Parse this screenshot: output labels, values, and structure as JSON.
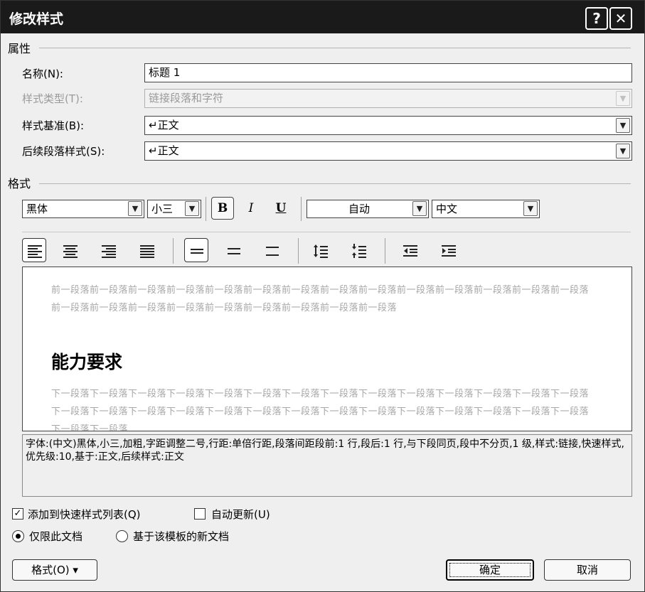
{
  "window": {
    "title": "修改样式",
    "help_label": "?",
    "close_label": "✕"
  },
  "properties": {
    "group_label": "属性",
    "name_label": "名称(N):",
    "name_value": "标题 1",
    "style_type_label": "样式类型(T):",
    "style_type_value": "链接段落和字符",
    "based_on_label": "样式基准(B):",
    "based_on_value": "↵正文",
    "following_label": "后续段落样式(S):",
    "following_value": "↵正文"
  },
  "format": {
    "group_label": "格式",
    "font_name": "黑体",
    "font_size": "小三",
    "bold_label": "B",
    "italic_label": "I",
    "underline_label": "U",
    "color_value": "自动",
    "script_value": "中文"
  },
  "preview": {
    "prev_paragraph": "前一段落前一段落前一段落前一段落前一段落前一段落前一段落前一段落前一段落前一段落前一段落前一段落前一段落前一段落前一段落前一段落前一段落前一段落前一段落前一段落前一段落前一段落前一段落",
    "heading": "能力要求",
    "next_paragraph": "下一段落下一段落下一段落下一段落下一段落下一段落下一段落下一段落下一段落下一段落下一段落下一段落下一段落下一段落下一段落下一段落下一段落下一段落下一段落下一段落下一段落下一段落下一段落下一段落下一段落下一段落下一段落下一段落下一段落下一段落"
  },
  "description": "字体:(中文)黑体,小三,加粗,字距调整二号,行距:单倍行距,段落间距段前:1 行,段后:1 行,与下段同页,段中不分页,1 级,样式:链接,快速样式,优先级:10,基于:正文,后续样式:正文",
  "options": {
    "add_quick_label": "添加到快速样式列表(Q)",
    "add_quick_checked": true,
    "auto_update_label": "自动更新(U)",
    "auto_update_checked": false,
    "only_doc_label": "仅限此文档",
    "template_label": "基于该模板的新文档",
    "selected_scope": "only_doc"
  },
  "buttons": {
    "format_label": "格式(O) ▾",
    "ok_label": "确定",
    "cancel_label": "取消"
  }
}
